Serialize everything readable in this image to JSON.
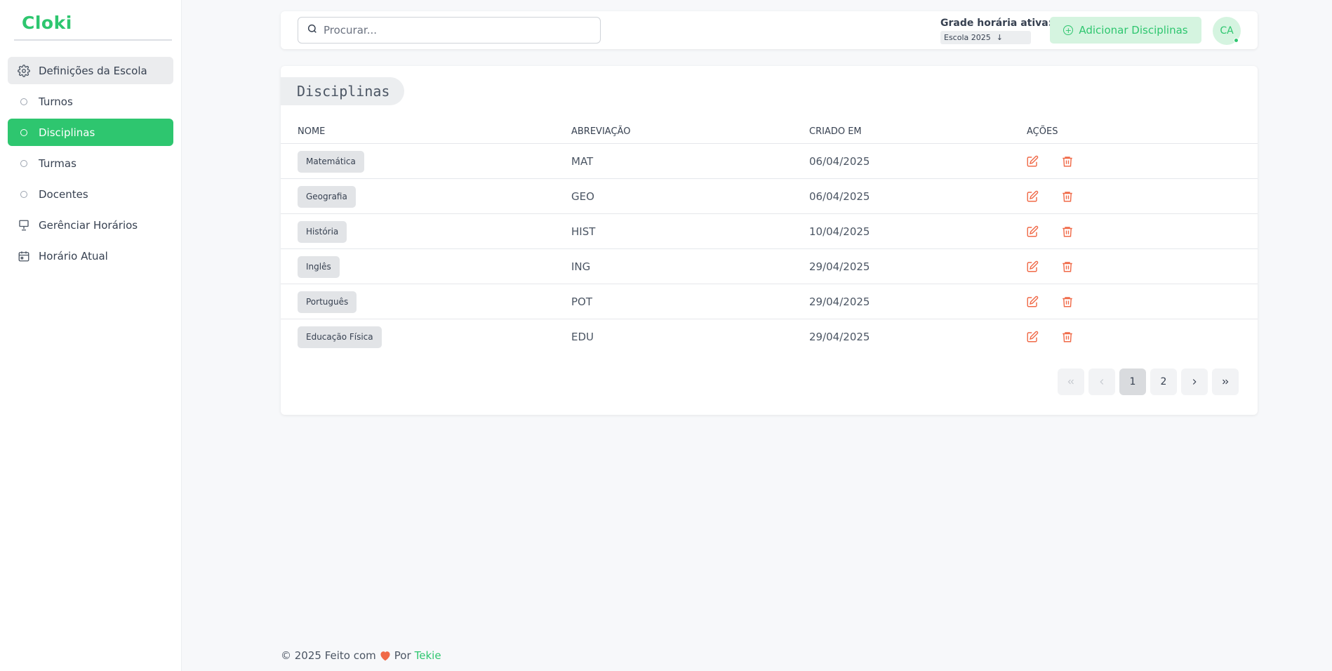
{
  "app": {
    "brand": "Cloki"
  },
  "sidebar": {
    "items": [
      {
        "label": "Definições da Escola",
        "icon": "gear-icon"
      },
      {
        "label": "Turnos",
        "icon": "circle-icon"
      },
      {
        "label": "Disciplinas",
        "icon": "circle-icon",
        "active": true
      },
      {
        "label": "Turmas",
        "icon": "circle-icon"
      },
      {
        "label": "Docentes",
        "icon": "circle-icon"
      },
      {
        "label": "Gerênciar Horários",
        "icon": "presentation-icon"
      },
      {
        "label": "Horário Atual",
        "icon": "calendar-icon"
      }
    ]
  },
  "topbar": {
    "search_placeholder": "Procurar...",
    "grade_label": "Grade horária ativa:",
    "grade_value": "Escola 2025",
    "add_button": "Adicionar Disciplinas",
    "avatar_initials": "CA"
  },
  "card": {
    "title": "Disciplinas",
    "columns": [
      "Nome",
      "Abreviação",
      "Criado em",
      "Ações"
    ],
    "rows": [
      {
        "nome": "Matemática",
        "abrev": "MAT",
        "criado": "06/04/2025"
      },
      {
        "nome": "Geografia",
        "abrev": "GEO",
        "criado": "06/04/2025"
      },
      {
        "nome": "História",
        "abrev": "HIST",
        "criado": "10/04/2025"
      },
      {
        "nome": "Inglês",
        "abrev": "ING",
        "criado": "29/04/2025"
      },
      {
        "nome": "Português",
        "abrev": "POT",
        "criado": "29/04/2025"
      },
      {
        "nome": "Educação Física",
        "abrev": "EDU",
        "criado": "29/04/2025"
      }
    ],
    "pagination": {
      "pages": [
        "1",
        "2"
      ],
      "current": "1"
    }
  },
  "footer": {
    "prefix": "© 2025 Feito com",
    "by": "Por",
    "author": "Tekie"
  },
  "colors": {
    "accent": "#2ec66f",
    "danger": "#f06a48"
  }
}
